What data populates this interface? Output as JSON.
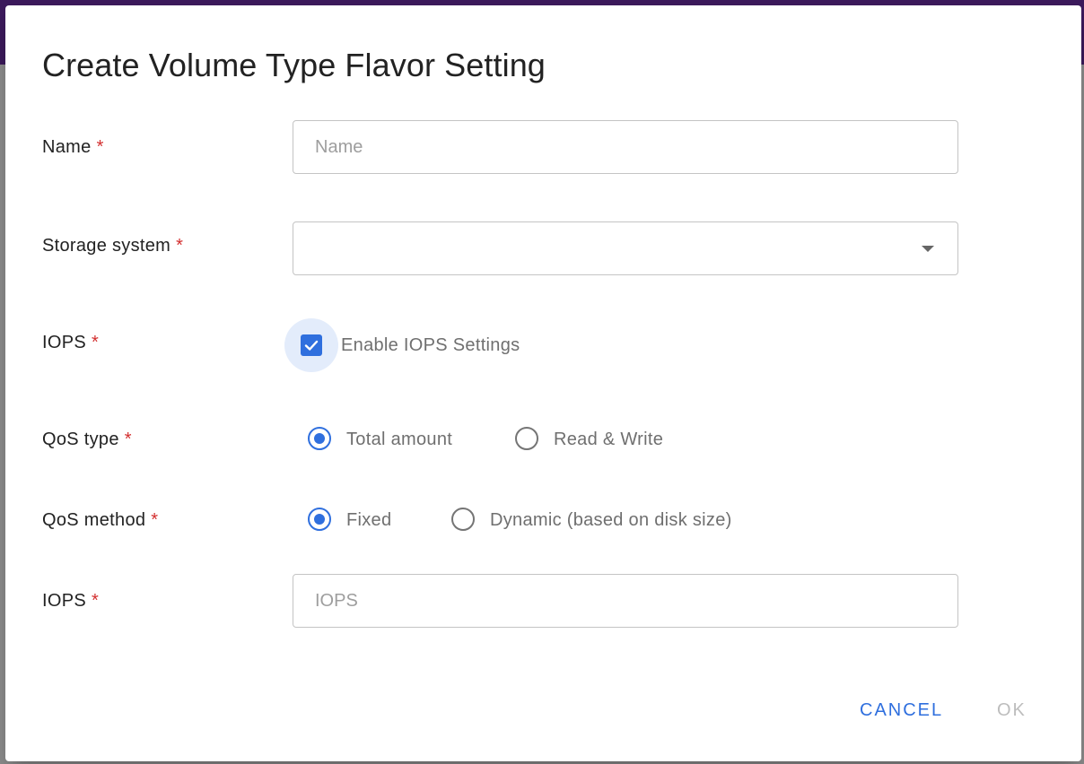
{
  "dialog": {
    "title": "Create Volume Type Flavor Setting",
    "required_marker": "*"
  },
  "fields": {
    "name": {
      "label": "Name",
      "placeholder": "Name",
      "value": ""
    },
    "storage_system": {
      "label": "Storage system",
      "value": "",
      "icon": "dropdown-arrow-icon"
    },
    "iops_enable": {
      "label": "IOPS",
      "checkbox_label": "Enable IOPS Settings",
      "checked": true
    },
    "qos_type": {
      "label": "QoS type",
      "options": [
        "Total amount",
        "Read & Write"
      ],
      "selected": "Total amount"
    },
    "qos_method": {
      "label": "QoS method",
      "options": [
        "Fixed",
        "Dynamic (based on disk size)"
      ],
      "selected": "Fixed"
    },
    "iops_value": {
      "label": "IOPS",
      "placeholder": "IOPS",
      "value": ""
    }
  },
  "actions": {
    "cancel_label": "CANCEL",
    "ok_label": "OK"
  },
  "colors": {
    "accent": "#2f6fde",
    "required": "#d32f2f",
    "disabled": "#bdbdbd"
  }
}
